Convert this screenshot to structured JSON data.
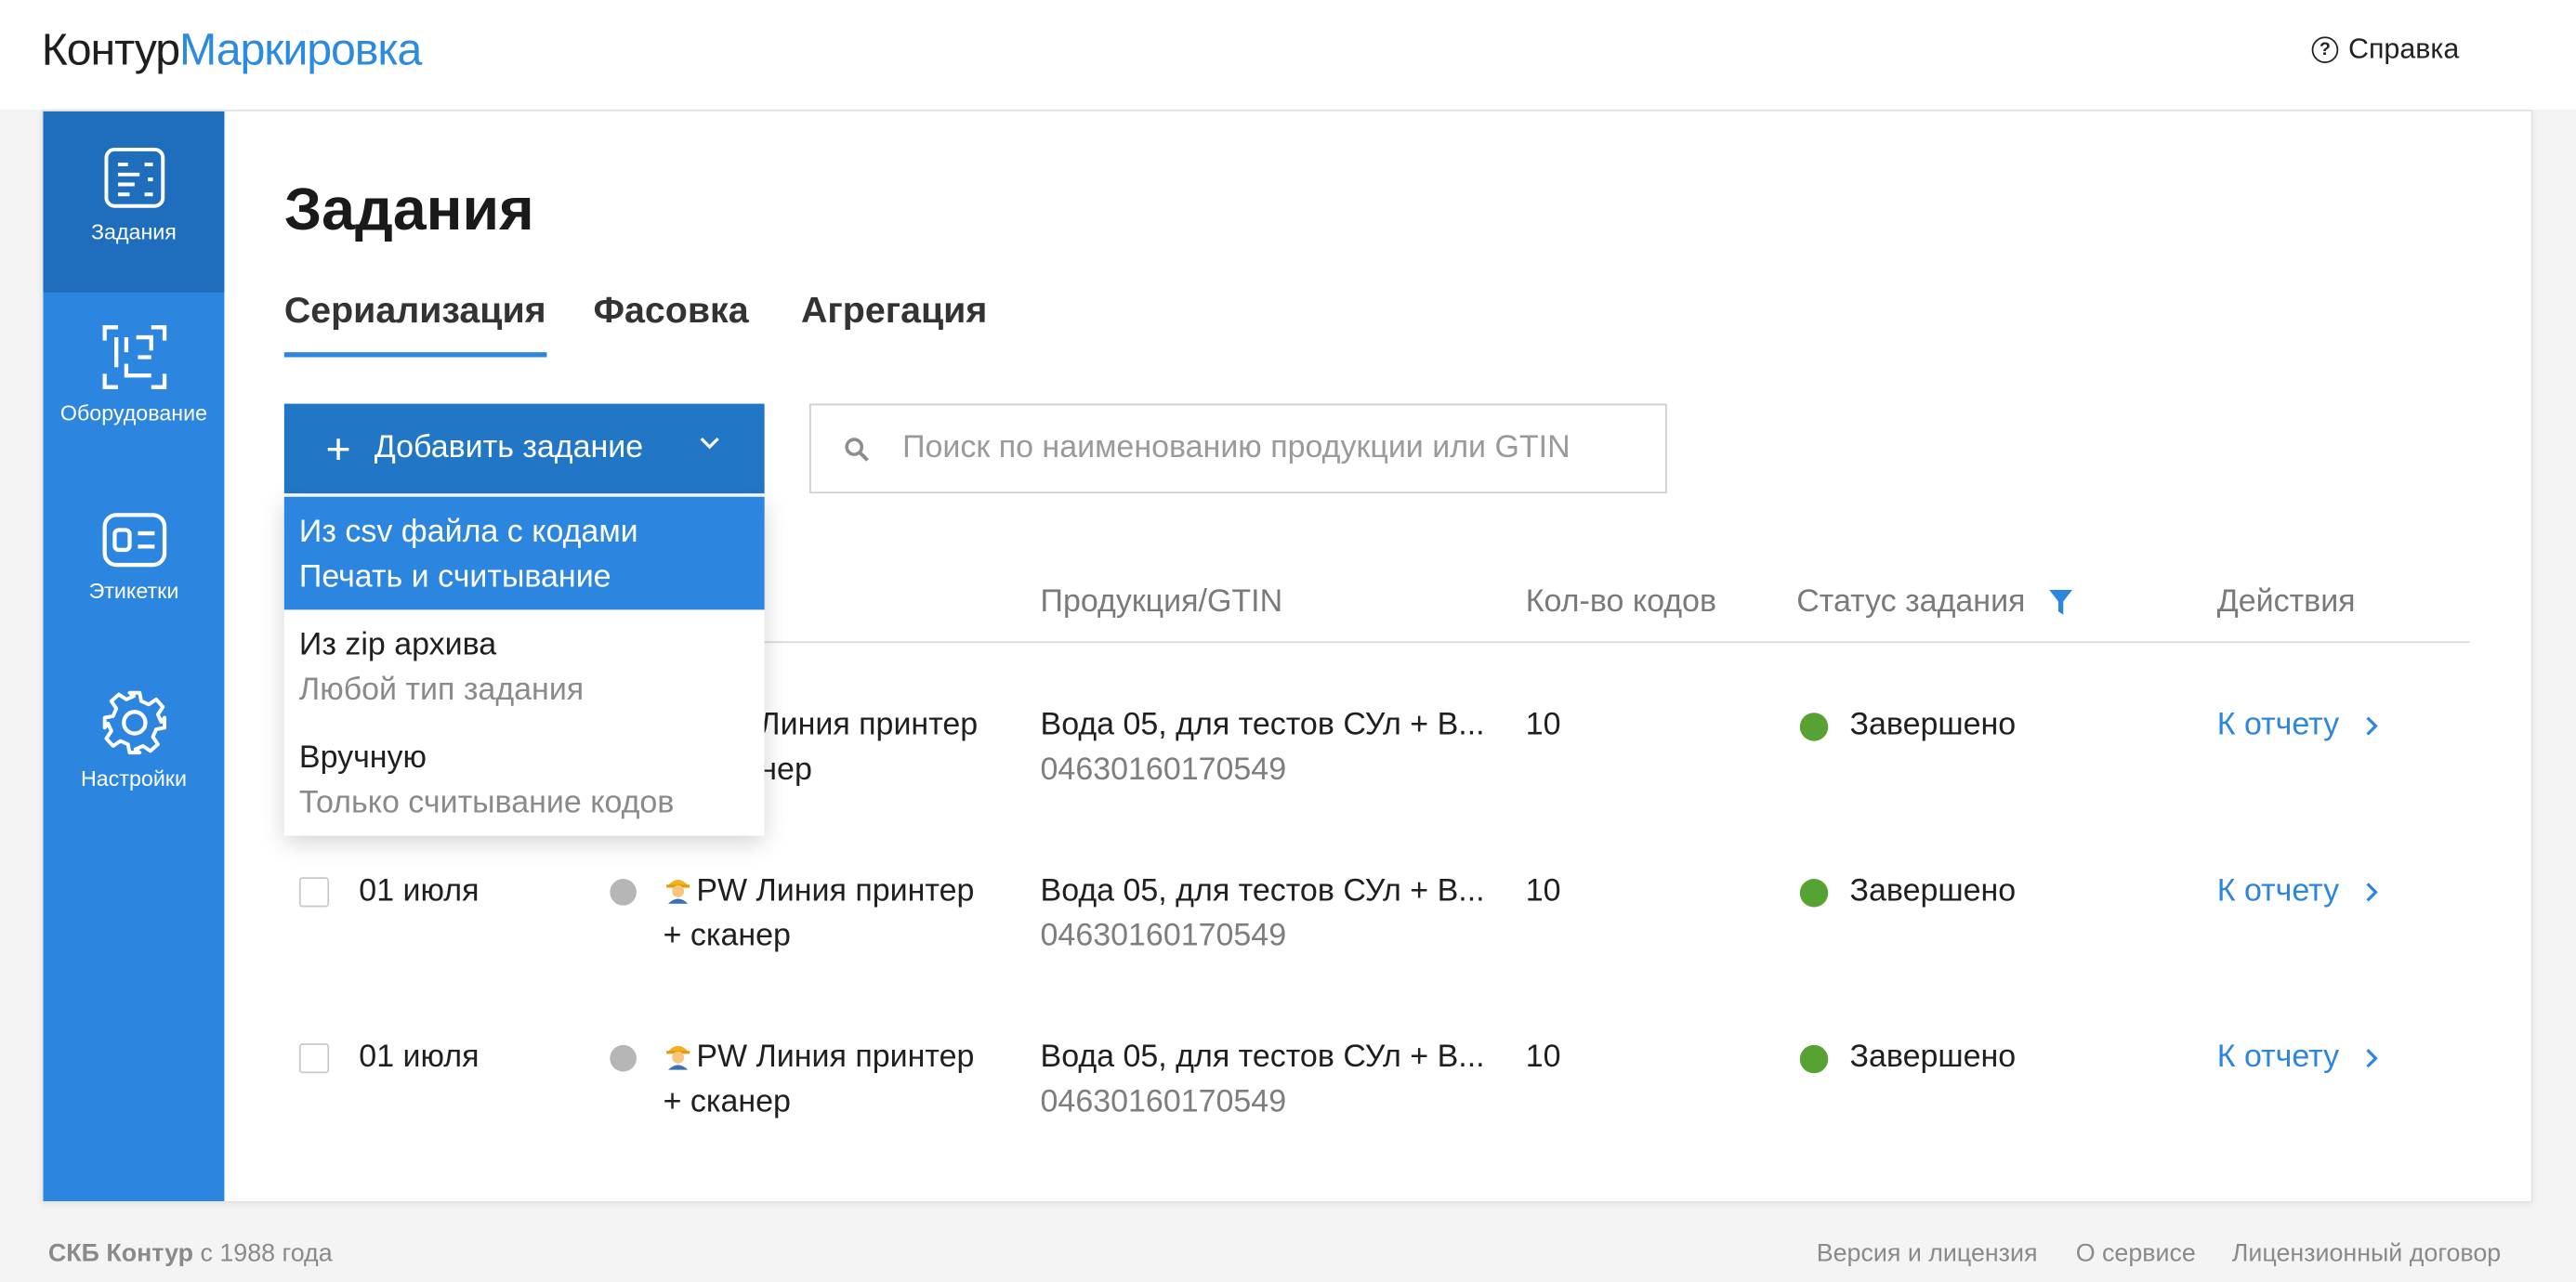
{
  "header": {
    "logo_part1": "Контур",
    "logo_part2": "Маркировка",
    "help_label": "Справка"
  },
  "sidebar": {
    "items": [
      {
        "label": "Задания",
        "icon": "tasks-icon",
        "active": true
      },
      {
        "label": "Оборудование",
        "icon": "equipment-icon",
        "active": false
      },
      {
        "label": "Этикетки",
        "icon": "labels-icon",
        "active": false
      },
      {
        "label": "Настройки",
        "icon": "settings-gear-icon",
        "active": false
      }
    ]
  },
  "main": {
    "title": "Задания",
    "tabs": [
      {
        "label": "Сериализация",
        "active": true
      },
      {
        "label": "Фасовка",
        "active": false
      },
      {
        "label": "Агрегация",
        "active": false
      }
    ],
    "add_button_label": "Добавить задание",
    "search_placeholder": "Поиск по наименованию продукции или GTIN"
  },
  "dropdown": {
    "items": [
      {
        "title": "Из csv файла с кодами",
        "subtitle": "Печать и считывание",
        "highlighted": true
      },
      {
        "title": "Из zip архива",
        "subtitle": "Любой тип задания",
        "highlighted": false
      },
      {
        "title": "Вручную",
        "subtitle": "Только считывание кодов",
        "highlighted": false
      }
    ]
  },
  "table": {
    "columns": [
      "Продукция/GTIN",
      "Кол-во кодов",
      "Статус задания",
      "Действия"
    ],
    "rows": [
      {
        "date": "",
        "line_part1": "Линия принтер",
        "line_part2": "нер",
        "product": "Вода 05, для тестов СУл + В...",
        "gtin": "04630160170549",
        "count": "10",
        "status": "Завершено",
        "action": "К отчету"
      },
      {
        "date": "01 июля",
        "line_part1": "PW Линия принтер",
        "line_part2": "+ сканер",
        "product": "Вода 05, для тестов СУл + В...",
        "gtin": "04630160170549",
        "count": "10",
        "status": "Завершено",
        "action": "К отчету"
      },
      {
        "date": "01 июля",
        "line_part1": "PW Линия принтер",
        "line_part2": "+ сканер",
        "product": "Вода 05, для тестов СУл + В...",
        "gtin": "04630160170549",
        "count": "10",
        "status": "Завершено",
        "action": "К отчету"
      }
    ]
  },
  "footer": {
    "company": "СКБ Контур",
    "since": " с 1988 года",
    "links": [
      "Версия и лицензия",
      "О сервисе",
      "Лицензионный договор"
    ]
  },
  "colors": {
    "accent": "#2c86df",
    "sidebar_active": "#1e6ebd",
    "button": "#2177c6",
    "status_done": "#56a233"
  }
}
